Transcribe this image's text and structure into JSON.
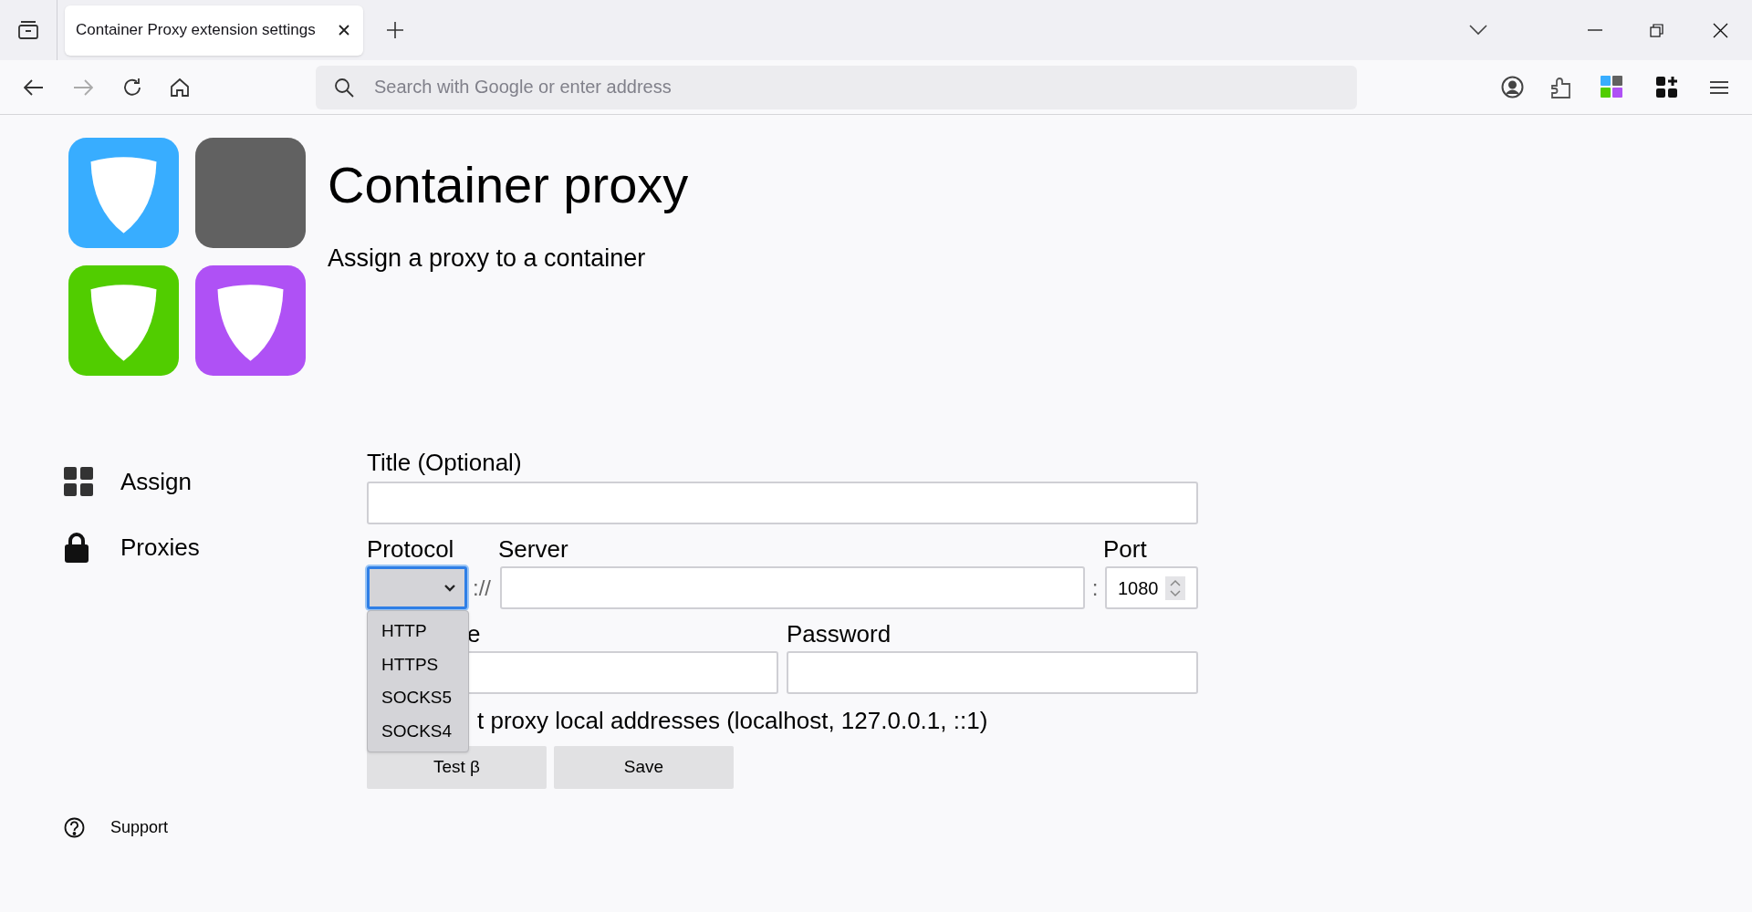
{
  "browser": {
    "tab_title": "Container Proxy extension settings",
    "address_placeholder": "Search with Google or enter address"
  },
  "header": {
    "title": "Container proxy",
    "subtitle": "Assign a proxy to a container"
  },
  "sidebar": {
    "items": [
      {
        "kind": "grid",
        "label": "Assign"
      },
      {
        "kind": "lock",
        "label": "Proxies"
      }
    ],
    "support": "Support"
  },
  "form": {
    "title_label": "Title (Optional)",
    "protocol_label": "Protocol",
    "server_label": "Server",
    "port_label": "Port",
    "scheme_separator": "://",
    "port_separator": ":",
    "port_value": "1080",
    "protocol_select": {
      "expanded": true,
      "options": [
        "HTTP",
        "HTTPS",
        "SOCKS5",
        "SOCKS4"
      ]
    },
    "username_label_visible": "e",
    "password_label": "Password",
    "local_checkbox_text_visible": "t proxy local addresses (localhost, 127.0.0.1, ::1)",
    "buttons": [
      "Test β",
      "Save"
    ]
  }
}
